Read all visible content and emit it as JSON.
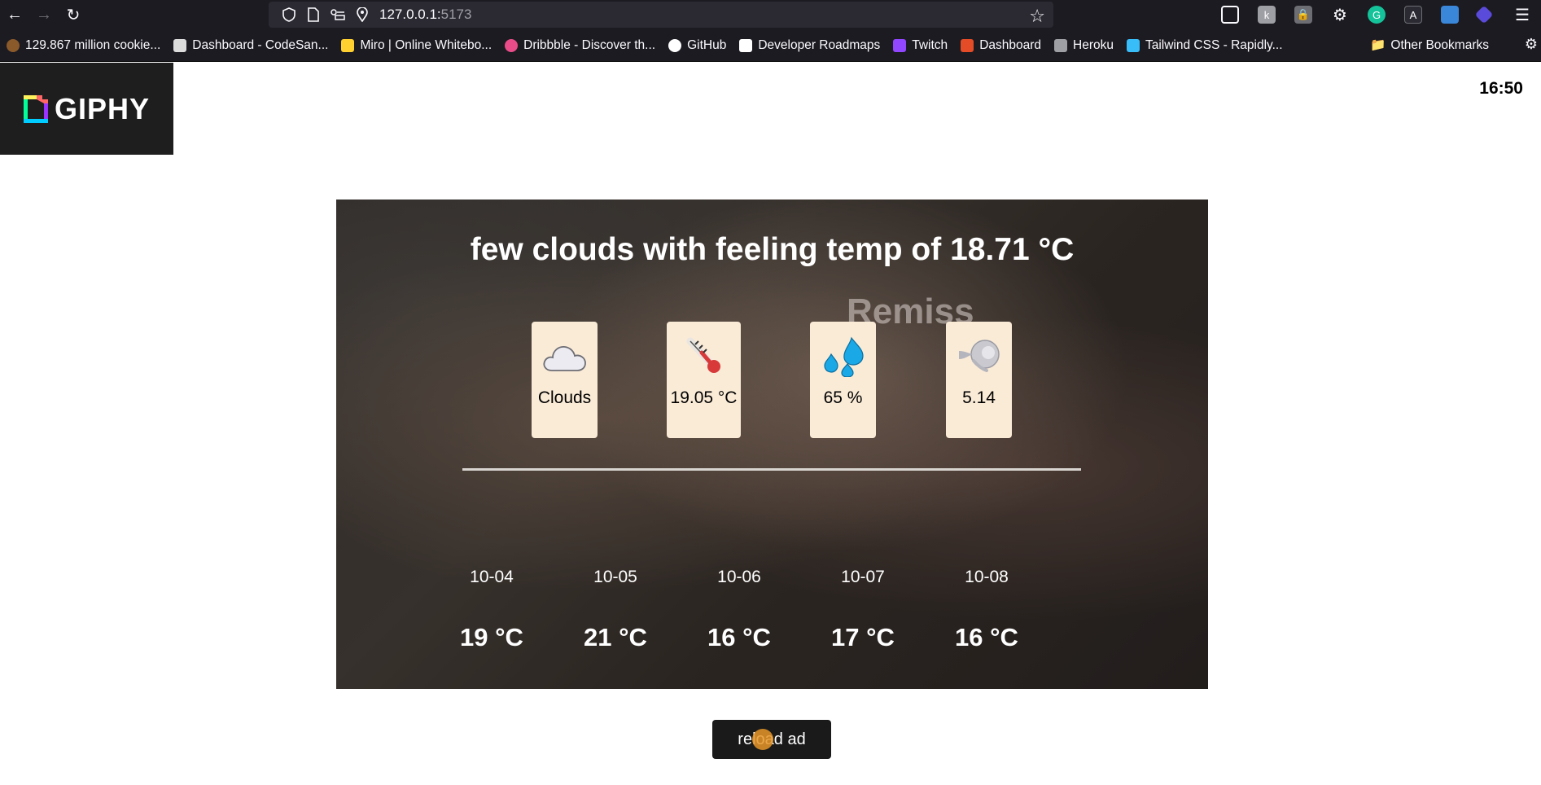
{
  "browser": {
    "url_host": "127.0.0.1:",
    "url_port": "5173",
    "bookmarks": [
      {
        "label": "129.867 million cookie...",
        "icon": "cookie-icon",
        "color": "#8b5a2b"
      },
      {
        "label": "Dashboard - CodeSan...",
        "icon": "codesandbox-icon",
        "color": "#dcdcdc"
      },
      {
        "label": "Miro | Online Whitebo...",
        "icon": "miro-icon",
        "color": "#ffd02f"
      },
      {
        "label": "Dribbble - Discover th...",
        "icon": "dribbble-icon",
        "color": "#ea4c89"
      },
      {
        "label": "GitHub",
        "icon": "github-icon",
        "color": "#ffffff"
      },
      {
        "label": "Developer Roadmaps",
        "icon": "roadmap-icon",
        "color": "#ffffff"
      },
      {
        "label": "Twitch",
        "icon": "twitch-icon",
        "color": "#9146ff"
      },
      {
        "label": "Dashboard",
        "icon": "dashboard-icon",
        "color": "#e34c26"
      },
      {
        "label": "Heroku",
        "icon": "heroku-icon",
        "color": "#9e9ea5"
      },
      {
        "label": "Tailwind CSS - Rapidly...",
        "icon": "tailwind-icon",
        "color": "#38bdf8"
      }
    ],
    "other_bookmarks": "Other Bookmarks"
  },
  "page": {
    "logo": "GIPHY",
    "clock": "16:50",
    "background_watermark": "Remiss",
    "headline": "few clouds with feeling temp of 18.71 °C",
    "stats": [
      {
        "icon": "cloud-icon",
        "value": "Clouds"
      },
      {
        "icon": "thermometer-icon",
        "value": "19.05 °C"
      },
      {
        "icon": "droplets-icon",
        "value": "65 %"
      },
      {
        "icon": "wind-icon",
        "value": "5.14"
      }
    ],
    "forecast": [
      {
        "date": "10-04",
        "temp": "19 °C"
      },
      {
        "date": "10-05",
        "temp": "21 °C"
      },
      {
        "date": "10-06",
        "temp": "16 °C"
      },
      {
        "date": "10-07",
        "temp": "17 °C"
      },
      {
        "date": "10-08",
        "temp": "16 °C"
      }
    ],
    "reload_button": "reload ad"
  }
}
